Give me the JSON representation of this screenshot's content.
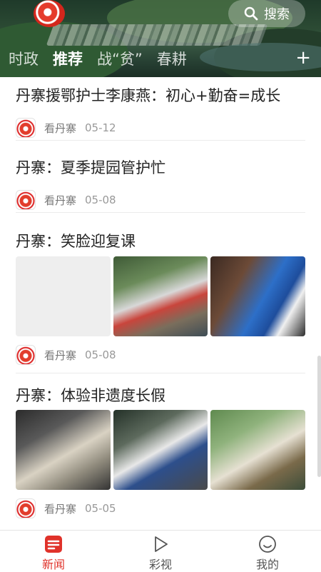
{
  "header": {
    "search_label": "搜索",
    "tabs": [
      {
        "label": "时政",
        "active": false
      },
      {
        "label": "推荐",
        "active": true
      },
      {
        "label": "战“贫”",
        "active": false
      },
      {
        "label": "春耕",
        "active": false
      }
    ],
    "add_label": "+"
  },
  "feed": [
    {
      "title": "丹寨援鄂护士李康燕：初心+勤奋=成长",
      "source": "看丹寨",
      "date": "05-12",
      "images": []
    },
    {
      "title": "丹寨：夏季提园管护忙",
      "source": "看丹寨",
      "date": "05-08",
      "images": []
    },
    {
      "title": "丹寨：笑脸迎复课",
      "source": "看丹寨",
      "date": "05-08",
      "images": [
        "blank-placeholder",
        "students-photo",
        "boy-in-blue-jacket-photo"
      ]
    },
    {
      "title": "丹寨：体验非遗度长假",
      "source": "看丹寨",
      "date": "05-05",
      "images": [
        "kids-papermaking-photo",
        "kids-craft-photo",
        "kids-painting-photo"
      ]
    }
  ],
  "bottom_nav": [
    {
      "label": "新闻",
      "icon": "news-icon",
      "active": true
    },
    {
      "label": "彩视",
      "icon": "play-icon",
      "active": false
    },
    {
      "label": "我的",
      "icon": "smile-icon",
      "active": false
    }
  ],
  "colors": {
    "accent": "#e0322a",
    "divider": "#ebebeb"
  }
}
